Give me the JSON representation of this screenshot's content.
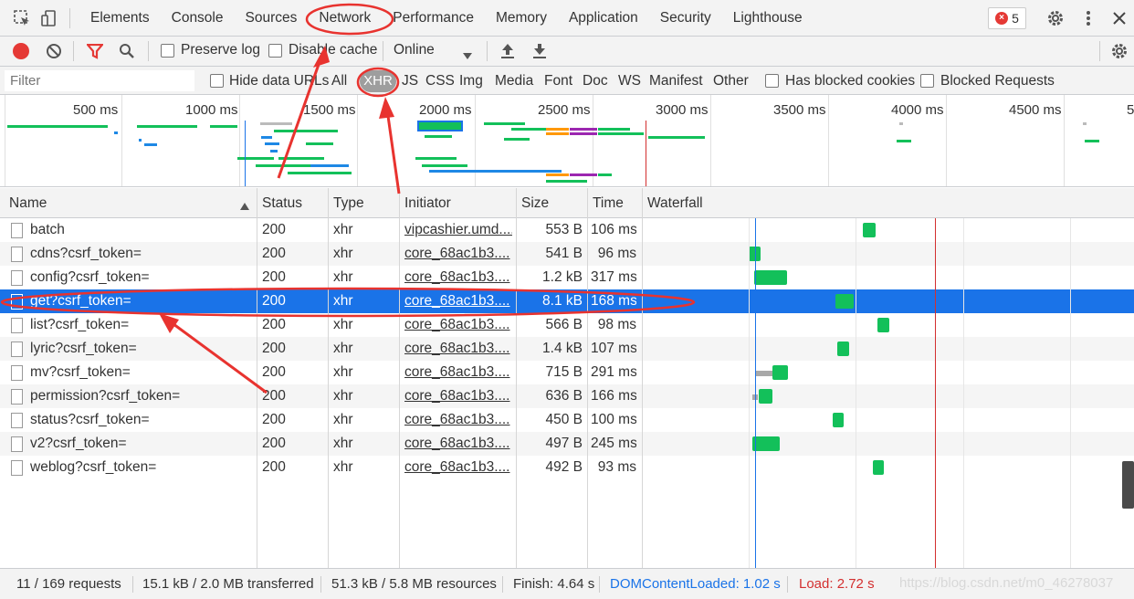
{
  "tabs": [
    "Elements",
    "Console",
    "Sources",
    "Network",
    "Performance",
    "Memory",
    "Application",
    "Security",
    "Lighthouse"
  ],
  "active_tab": "Network",
  "error_count": "5",
  "toolbar": {
    "preserve_log": "Preserve log",
    "disable_cache": "Disable cache",
    "throttle": "Online"
  },
  "filter": {
    "placeholder": "Filter",
    "hide_data_urls": "Hide data URLs",
    "types": [
      "All",
      "XHR",
      "JS",
      "CSS",
      "Img",
      "Media",
      "Font",
      "Doc",
      "WS",
      "Manifest",
      "Other"
    ],
    "active_type": "XHR",
    "has_blocked_cookies": "Has blocked cookies",
    "blocked_requests": "Blocked Requests"
  },
  "overview": {
    "ticks": [
      "500 ms",
      "1000 ms",
      "1500 ms",
      "2000 ms",
      "2500 ms",
      "3000 ms",
      "3500 ms",
      "4000 ms",
      "4500 ms",
      "5"
    ]
  },
  "table": {
    "columns": [
      "Name",
      "Status",
      "Type",
      "Initiator",
      "Size",
      "Time",
      "Waterfall"
    ],
    "rows": [
      {
        "name": "batch",
        "status": "200",
        "type": "xhr",
        "initiator": "vipcashier.umd....",
        "size": "553 B",
        "time": "106 ms"
      },
      {
        "name": "cdns?csrf_token=",
        "status": "200",
        "type": "xhr",
        "initiator": "core_68ac1b3....",
        "size": "541 B",
        "time": "96 ms"
      },
      {
        "name": "config?csrf_token=",
        "status": "200",
        "type": "xhr",
        "initiator": "core_68ac1b3....",
        "size": "1.2 kB",
        "time": "317 ms"
      },
      {
        "name": "get?csrf_token=",
        "status": "200",
        "type": "xhr",
        "initiator": "core_68ac1b3....",
        "size": "8.1 kB",
        "time": "168 ms"
      },
      {
        "name": "list?csrf_token=",
        "status": "200",
        "type": "xhr",
        "initiator": "core_68ac1b3....",
        "size": "566 B",
        "time": "98 ms"
      },
      {
        "name": "lyric?csrf_token=",
        "status": "200",
        "type": "xhr",
        "initiator": "core_68ac1b3....",
        "size": "1.4 kB",
        "time": "107 ms"
      },
      {
        "name": "mv?csrf_token=",
        "status": "200",
        "type": "xhr",
        "initiator": "core_68ac1b3....",
        "size": "715 B",
        "time": "291 ms"
      },
      {
        "name": "permission?csrf_token=",
        "status": "200",
        "type": "xhr",
        "initiator": "core_68ac1b3....",
        "size": "636 B",
        "time": "166 ms"
      },
      {
        "name": "status?csrf_token=",
        "status": "200",
        "type": "xhr",
        "initiator": "core_68ac1b3....",
        "size": "450 B",
        "time": "100 ms"
      },
      {
        "name": "v2?csrf_token=",
        "status": "200",
        "type": "xhr",
        "initiator": "core_68ac1b3....",
        "size": "497 B",
        "time": "245 ms"
      },
      {
        "name": "weblog?csrf_token=",
        "status": "200",
        "type": "xhr",
        "initiator": "core_68ac1b3....",
        "size": "492 B",
        "time": "93 ms"
      }
    ],
    "selected_row": 3
  },
  "status_bar": {
    "requests": "11 / 169 requests",
    "transferred": "15.1 kB / 2.0 MB transferred",
    "resources": "51.3 kB / 5.8 MB resources",
    "finish": "Finish: 4.64 s",
    "dom_content_loaded": "DOMContentLoaded: 1.02 s",
    "load": "Load: 2.72 s"
  },
  "watermark": "https://blog.csdn.net/m0_46278037",
  "colors": {
    "accent_blue": "#1a73e8",
    "record_red": "#e53935",
    "bar_green": "#13c05a",
    "annotation_red": "#e8332f",
    "dcl_blue": "#1a73e8",
    "load_red": "#d32f2f"
  }
}
